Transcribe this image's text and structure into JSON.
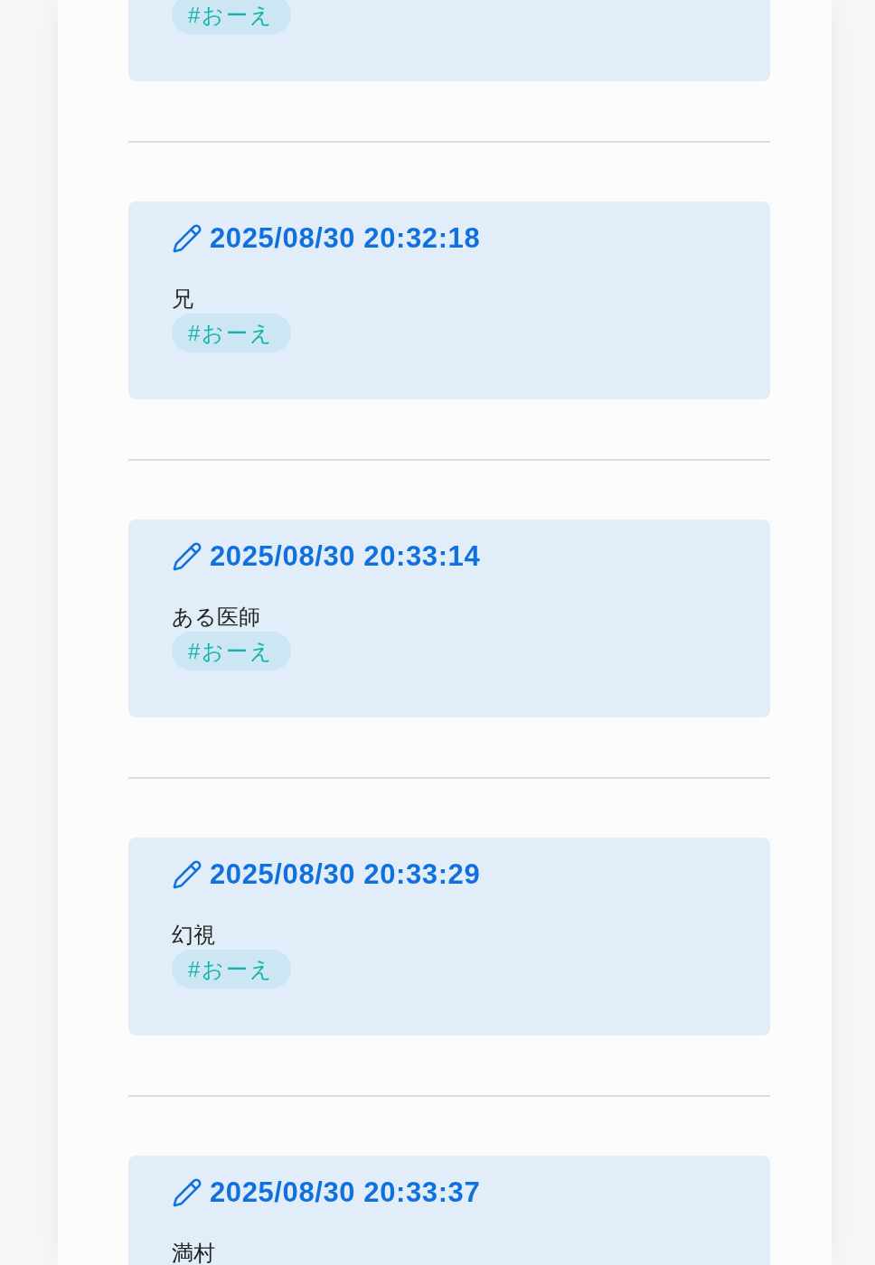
{
  "entries": [
    {
      "tags": [
        "#おーえ"
      ]
    },
    {
      "date": "2025/08/30 20:32:18",
      "body": "兄",
      "tags": [
        "#おーえ"
      ]
    },
    {
      "date": "2025/08/30 20:33:14",
      "body": "ある医師",
      "tags": [
        "#おーえ"
      ]
    },
    {
      "date": "2025/08/30 20:33:29",
      "body": "幻視",
      "tags": [
        "#おーえ"
      ]
    },
    {
      "date": "2025/08/30 20:33:37",
      "body": "満村"
    }
  ]
}
